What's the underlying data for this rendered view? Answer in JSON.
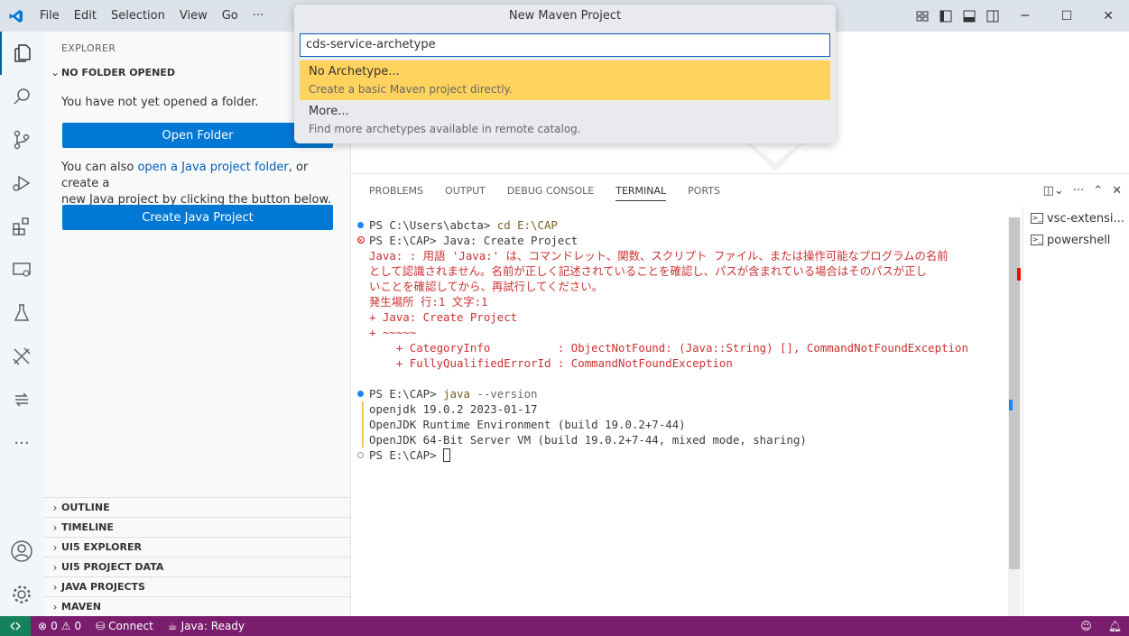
{
  "menu": [
    "File",
    "Edit",
    "Selection",
    "View",
    "Go",
    "···"
  ],
  "quickpick": {
    "title": "New Maven Project",
    "input_value": "cds-service-archetype",
    "items": [
      {
        "label": "No Archetype...",
        "description": "Create a basic Maven project directly."
      },
      {
        "label": "More...",
        "description": "Find more archetypes available in remote catalog."
      }
    ]
  },
  "sidebar": {
    "title": "EXPLORER",
    "section": "NO FOLDER OPENED",
    "no_folder_text": "You have not yet opened a folder.",
    "open_folder_button": "Open Folder",
    "java_text_pre": "You can also ",
    "java_link": "open a Java project folder",
    "java_text_post": ", or create a",
    "java_text_line2": "new Java project by clicking the button below.",
    "create_java_button": "Create Java Project",
    "panes": [
      "OUTLINE",
      "TIMELINE",
      "UI5 EXPLORER",
      "UI5 PROJECT DATA",
      "JAVA PROJECTS",
      "MAVEN"
    ]
  },
  "panel": {
    "tabs": [
      "PROBLEMS",
      "OUTPUT",
      "DEBUG CONSOLE",
      "TERMINAL",
      "PORTS"
    ],
    "active_tab": "TERMINAL",
    "terminals": [
      "vsc-extensi...",
      "powershell"
    ]
  },
  "terminal": {
    "l1_prompt": "PS C:\\Users\\abcta> ",
    "l1_cmd": "cd E:\\CAP",
    "l2_prompt": "PS E:\\CAP> ",
    "l2_cmd": "Java: Create Project",
    "err1": "Java: : 用語 'Java:' は、コマンドレット、関数、スクリプト ファイル、または操作可能なプログラムの名前",
    "err2": "として認識されません。名前が正しく記述されていることを確認し、パスが含まれている場合はそのパスが正し",
    "err3": "いことを確認してから、再試行してください。",
    "err4": "発生場所 行:1 文字:1",
    "err5": "+ Java: Create Project",
    "err6": "+ ~~~~~",
    "err7": "    + CategoryInfo          : ObjectNotFound: (Java::String) [], CommandNotFoundException",
    "err8": "    + FullyQualifiedErrorId : CommandNotFoundException",
    "l3_prompt": "PS E:\\CAP> ",
    "l3_cmd": "java",
    "l3_flag": " --version",
    "out1": "openjdk 19.0.2 2023-01-17",
    "out2": "OpenJDK Runtime Environment (build 19.0.2+7-44)",
    "out3": "OpenJDK 64-Bit Server VM (build 19.0.2+7-44, mixed mode, sharing)",
    "l4_prompt": "PS E:\\CAP> "
  },
  "status": {
    "errors": "0",
    "warnings": "0",
    "connect": "Connect",
    "java": "Java: Ready"
  },
  "colors": {
    "accent": "#005fb8",
    "statusbar": "#7a1d6c",
    "selected": "#ffd35e",
    "error": "#cd3131"
  }
}
